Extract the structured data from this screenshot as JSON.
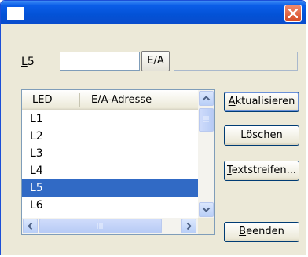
{
  "window": {
    "title": ""
  },
  "l5_row": {
    "label_mnemonic": "L",
    "label_rest": "5",
    "input_value": "",
    "ea_button_label": "E/A",
    "readonly_value": ""
  },
  "listview": {
    "columns": [
      "LED",
      "E/A-Adresse"
    ],
    "rows": [
      {
        "led": "L1",
        "addr": ""
      },
      {
        "led": "L2",
        "addr": ""
      },
      {
        "led": "L3",
        "addr": ""
      },
      {
        "led": "L4",
        "addr": ""
      },
      {
        "led": "L5",
        "addr": ""
      },
      {
        "led": "L6",
        "addr": ""
      }
    ],
    "selected_index": 4
  },
  "buttons": {
    "aktualisieren": {
      "mnemonic": "A",
      "rest": "ktualisieren"
    },
    "loeschen": {
      "before": "Lös",
      "mnemonic": "c",
      "after": "hen"
    },
    "textstreifen": {
      "mnemonic": "T",
      "rest": "extstreifen..."
    },
    "beenden": {
      "mnemonic": "B",
      "rest": "eenden"
    }
  },
  "colors": {
    "selection": "#316ac5",
    "titlebar": "#0352d6",
    "close": "#d54c25"
  },
  "icons": [
    "window-icon",
    "close-icon",
    "scroll-up-arrow-icon",
    "scroll-down-arrow-icon",
    "scroll-left-arrow-icon",
    "scroll-right-arrow-icon",
    "size-grip-icon"
  ]
}
